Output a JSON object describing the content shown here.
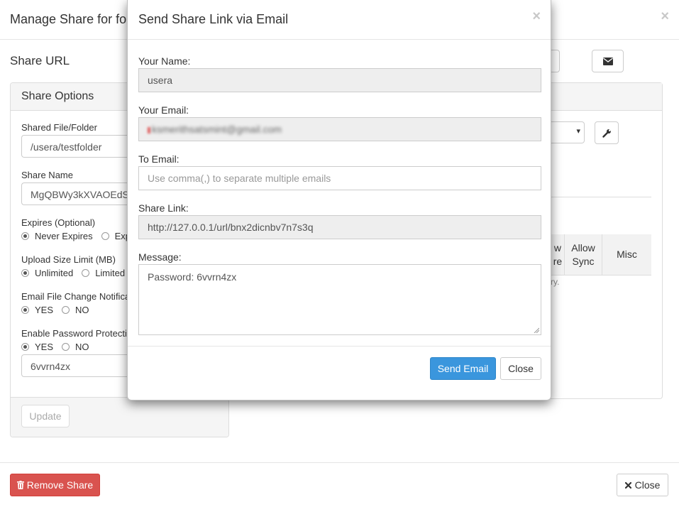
{
  "background_modal": {
    "title": "Manage Share for fo",
    "close_glyph": "×",
    "share_url_label": "Share URL",
    "share_options_title": "Share Options",
    "shared_file_label": "Shared File/Folder",
    "shared_file_value": "/usera/testfolder",
    "share_name_label": "Share Name",
    "share_name_value": "MgQBWy3kXVAOEdS",
    "expires_label": "Expires (Optional)",
    "expires_options": [
      "Never Expires",
      "Exp"
    ],
    "upload_limit_label": "Upload Size Limit (MB)",
    "upload_limit_options": [
      "Unlimited",
      "Limited"
    ],
    "email_change_label": "Email File Change Notifica",
    "email_change_options": [
      "YES",
      "NO"
    ],
    "password_protect_label": "Enable Password Protecti",
    "password_protect_options": [
      "YES",
      "NO"
    ],
    "password_value": "6vvrn4zx",
    "update_button": "Update",
    "select_caret": "▾",
    "table_headers": [
      "w\nre",
      "Allow\nSync",
      "Misc"
    ],
    "trunc_note": "ry.",
    "remove_share_button": "Remove Share",
    "close_button": "Close",
    "icons": {
      "mail": "envelope-icon",
      "wrench": "wrench-icon",
      "trash": "trash-icon",
      "close": "times-icon"
    }
  },
  "dialog": {
    "title": "Send Share Link via Email",
    "close_glyph": "×",
    "your_name_label": "Your Name:",
    "your_name_value": "usera",
    "your_email_label": "Your Email:",
    "your_email_value": "ksmerithsatsmint@gmail.com",
    "to_email_label": "To Email:",
    "to_email_placeholder": "Use comma(,) to separate multiple emails",
    "share_link_label": "Share Link:",
    "share_link_value": "http://127.0.0.1/url/bnx2dicnbv7n7s3q",
    "message_label": "Message:",
    "message_value": "Password: 6vvrn4zx",
    "send_button": "Send Email",
    "close_button": "Close"
  },
  "colors": {
    "primary": "#3a96dd",
    "danger": "#d9534f",
    "readonly_bg": "#eeeeee"
  }
}
